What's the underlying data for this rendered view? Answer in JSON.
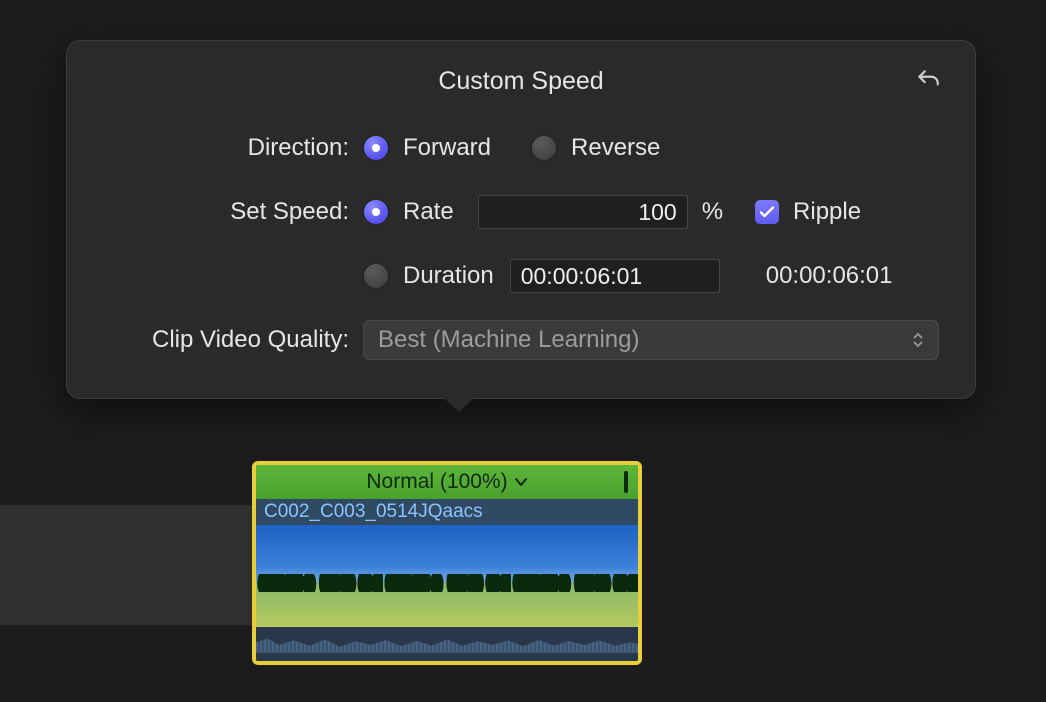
{
  "popover": {
    "title": "Custom Speed",
    "direction": {
      "label": "Direction:",
      "forward": "Forward",
      "reverse": "Reverse",
      "selected": "forward"
    },
    "setspeed": {
      "label": "Set Speed:",
      "rate_label": "Rate",
      "rate_value": "100",
      "rate_unit": "%",
      "duration_label": "Duration",
      "duration_value": "00:00:06:01",
      "duration_readout": "00:00:06:01",
      "selected": "rate",
      "ripple_label": "Ripple",
      "ripple_checked": true
    },
    "quality": {
      "label": "Clip Video Quality:",
      "value": "Best (Machine Learning)"
    }
  },
  "clip": {
    "speed_label": "Normal (100%)",
    "name": "C002_C003_0514JQaacs"
  }
}
